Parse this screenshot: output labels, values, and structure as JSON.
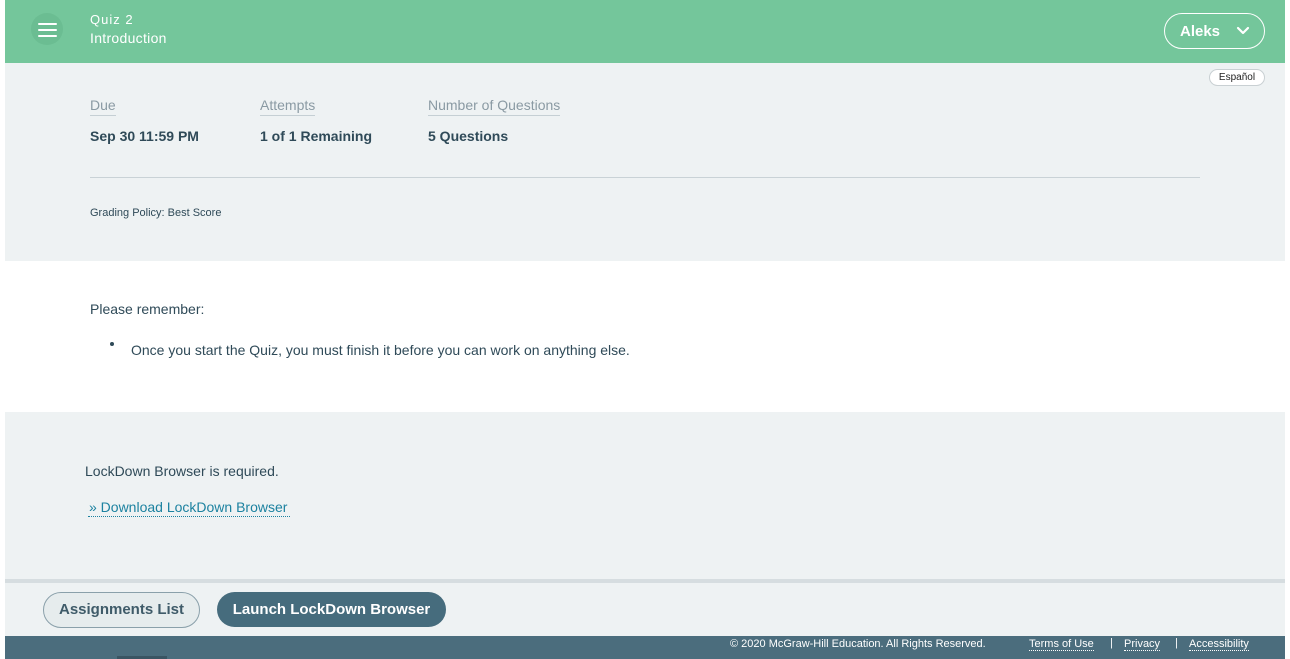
{
  "header": {
    "menu_icon": "hamburger-menu-icon",
    "title": "Quiz 2",
    "subtitle": "Introduction",
    "user_label": "Aleks",
    "user_icon": "chevron-down-icon",
    "bg_color": "#74c69b"
  },
  "info": {
    "language_label": "Español",
    "due_label": "Due",
    "due_value": "Sep 30 11:59 PM",
    "attempts_label": "Attempts",
    "attempts_value": "1 of 1 Remaining",
    "questions_label": "Number of Questions",
    "questions_value": "5 Questions",
    "grading_policy": "Grading Policy: Best Score"
  },
  "reminder": {
    "heading": "Please remember:",
    "items": [
      "Once you start the Quiz, you must finish it before you can work on anything else."
    ]
  },
  "lockdown": {
    "required_text": "LockDown Browser is required.",
    "download_link": "» Download LockDown Browser"
  },
  "actions": {
    "assignments_label": "Assignments List",
    "launch_label": "Launch LockDown Browser",
    "launch_color": "#466c7d"
  },
  "footer": {
    "copyright": "© 2020 McGraw-Hill Education. All Rights Reserved.",
    "terms": "Terms of Use",
    "privacy": "Privacy",
    "accessibility": "Accessibility",
    "separator": "|",
    "bg_color": "#4b6d7d"
  }
}
